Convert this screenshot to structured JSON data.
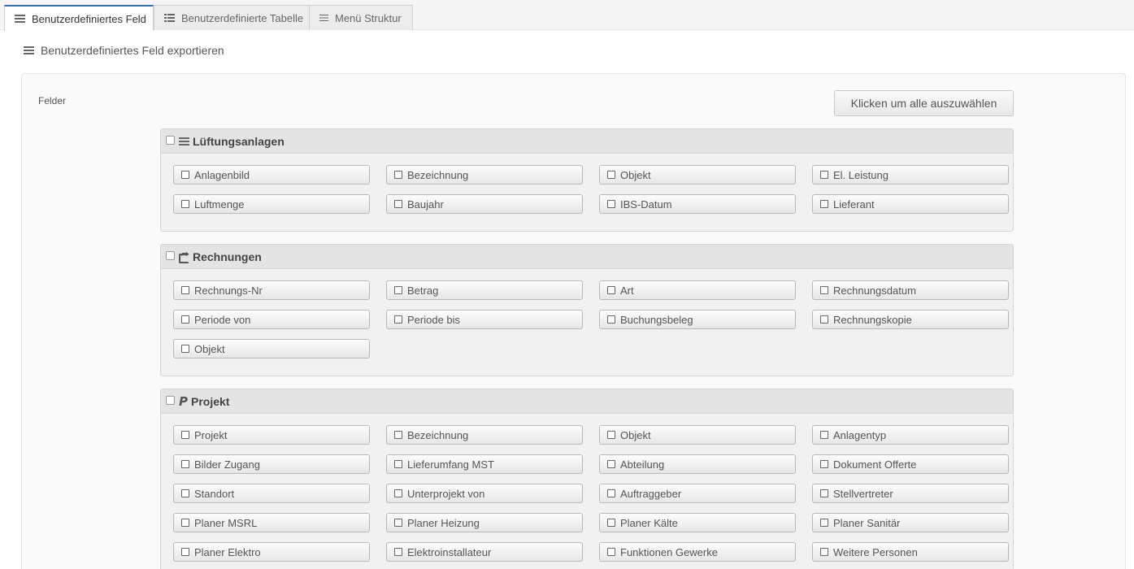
{
  "tabs": [
    {
      "label": "Benutzerdefiniertes Feld",
      "icon": "list-icon",
      "active": true
    },
    {
      "label": "Benutzerdefinierte Tabelle",
      "icon": "table-icon",
      "active": false
    },
    {
      "label": "Menü Struktur",
      "icon": "menu-icon",
      "active": false
    }
  ],
  "heading": {
    "title": "Benutzerdefiniertes Feld exportieren",
    "icon": "list-icon"
  },
  "form": {
    "felder_label": "Felder",
    "select_all_label": "Klicken um alle auszuwählen"
  },
  "groups": [
    {
      "title": "Lüftungsanlagen",
      "icon": "list-icon",
      "fields": [
        "Anlagenbild",
        "Bezeichnung",
        "Objekt",
        "El. Leistung",
        "Luftmenge",
        "Baujahr",
        "IBS-Datum",
        "Lieferant"
      ]
    },
    {
      "title": "Rechnungen",
      "icon": "share-square-icon",
      "fields": [
        "Rechnungs-Nr",
        "Betrag",
        "Art",
        "Rechnungsdatum",
        "Periode von",
        "Periode bis",
        "Buchungsbeleg",
        "Rechnungskopie",
        "Objekt"
      ]
    },
    {
      "title": "Projekt",
      "icon": "paypal-icon",
      "fields": [
        "Projekt",
        "Bezeichnung",
        "Objekt",
        "Anlagentyp",
        "Bilder Zugang",
        "Lieferumfang MST",
        "Abteilung",
        "Dokument Offerte",
        "Standort",
        "Unterprojekt von",
        "Auftraggeber",
        "Stellvertreter",
        "Planer MSRL",
        "Planer Heizung",
        "Planer Kälte",
        "Planer Sanitär",
        "Planer Elektro",
        "Elektroinstallateur",
        "Funktionen Gewerke",
        "Weitere Personen"
      ]
    }
  ]
}
